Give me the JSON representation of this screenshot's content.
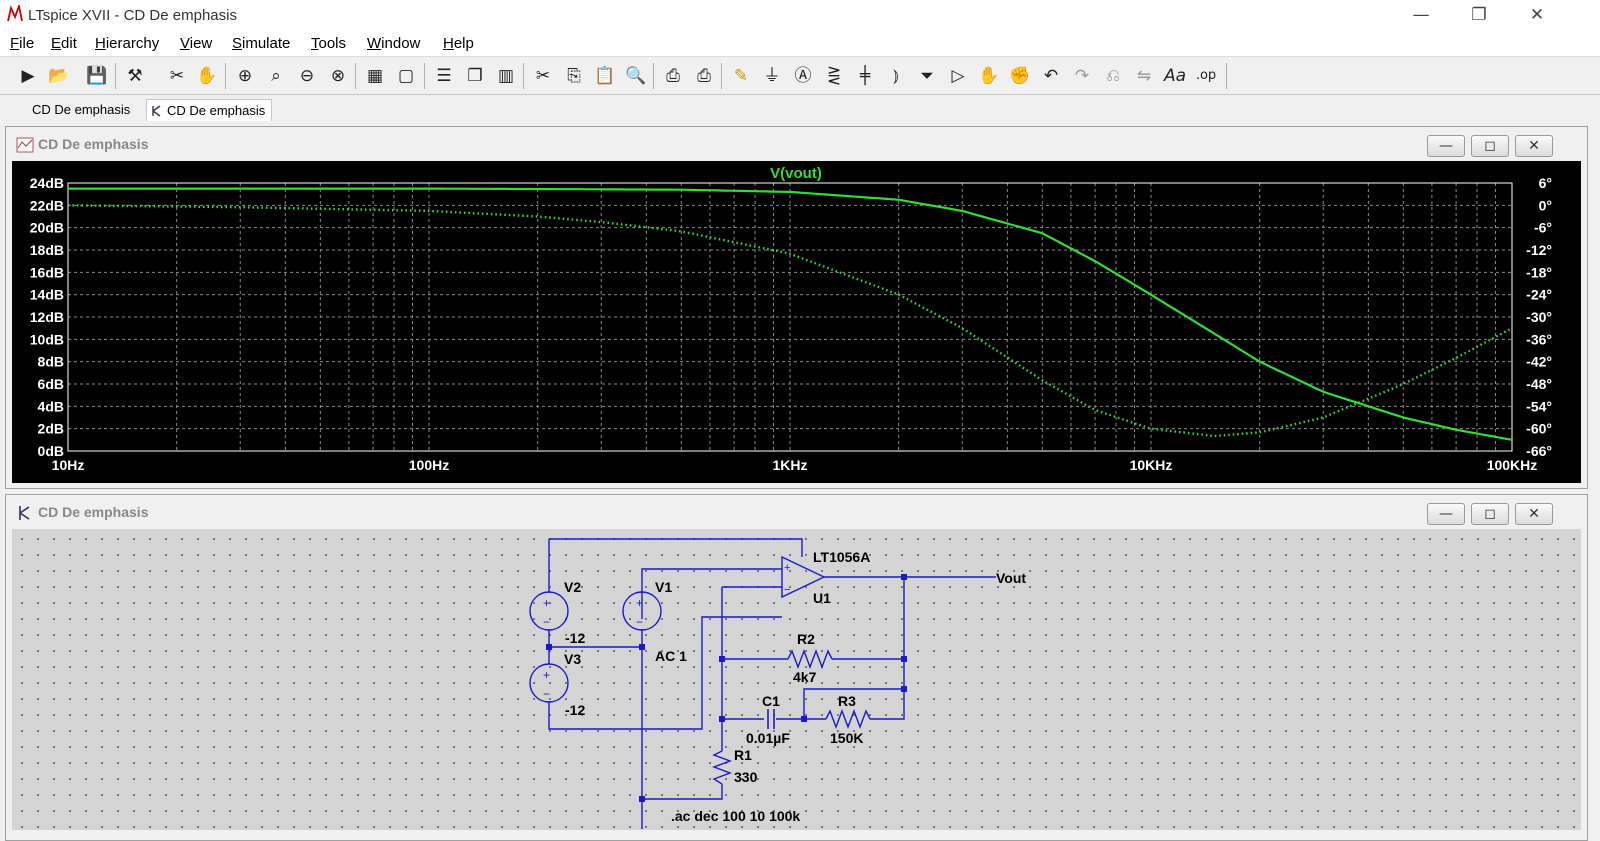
{
  "window": {
    "title": "LTspice XVII - CD De emphasis",
    "controls": {
      "minimize": "—",
      "restore": "❐",
      "close": "✕"
    }
  },
  "menu": [
    {
      "label": "File",
      "underline": "F"
    },
    {
      "label": "Edit",
      "underline": "E"
    },
    {
      "label": "Hierarchy",
      "underline": "H"
    },
    {
      "label": "View",
      "underline": "V"
    },
    {
      "label": "Simulate",
      "underline": "S"
    },
    {
      "label": "Tools",
      "underline": "T"
    },
    {
      "label": "Window",
      "underline": "W"
    },
    {
      "label": "Help",
      "underline": "H"
    }
  ],
  "toolbar_icons": [
    "run-icon",
    "open-icon",
    "save-icon",
    "control-panel-icon",
    "halt-icon",
    "pan-icon",
    "zoom-in-icon",
    "zoom-extents-icon",
    "zoom-out-icon",
    "zoom-cancel-icon",
    "autorange-icon",
    "mark-unconnected-icon",
    "tile-horizontal-icon",
    "cascade-icon",
    "tile-vertical-icon",
    "cut-icon",
    "copy-icon",
    "paste-icon",
    "find-icon",
    "print-icon",
    "print-setup-icon",
    "wire-icon",
    "ground-icon",
    "label-net-icon",
    "resistor-icon",
    "capacitor-icon",
    "inductor-icon",
    "diode-icon",
    "component-icon",
    "move-icon",
    "drag-icon",
    "undo-icon",
    "redo-icon",
    "rotate-icon",
    "mirror-icon",
    "text-icon",
    "spice-directive-icon"
  ],
  "tabs": [
    {
      "label": "CD De emphasis"
    },
    {
      "label": "CD De emphasis"
    }
  ],
  "plot_window": {
    "title": "CD De emphasis",
    "trace_name": "V(vout)",
    "trace_color": "#33dd33",
    "y_left_ticks": [
      "24dB",
      "22dB",
      "20dB",
      "18dB",
      "16dB",
      "14dB",
      "12dB",
      "10dB",
      "8dB",
      "6dB",
      "4dB",
      "2dB",
      "0dB"
    ],
    "y_right_ticks": [
      "6°",
      "0°",
      "-6°",
      "-12°",
      "-18°",
      "-24°",
      "-30°",
      "-36°",
      "-42°",
      "-48°",
      "-54°",
      "-60°",
      "-66°"
    ],
    "x_ticks": [
      "10Hz",
      "100Hz",
      "1KHz",
      "10KHz",
      "100KHz"
    ]
  },
  "chart_data": {
    "type": "line",
    "title": "V(vout)",
    "xlabel": "",
    "ylabel": "",
    "x_scale": "log",
    "xlim": [
      10,
      100000
    ],
    "ylim": [
      0,
      24
    ],
    "y2lim": [
      -66,
      6
    ],
    "grid": true,
    "series": [
      {
        "name": "V(vout)",
        "style": "solid",
        "axis": "left",
        "unit": "dB",
        "x": [
          10,
          100,
          500,
          1000,
          2000,
          3000,
          5000,
          7000,
          10000,
          15000,
          20000,
          30000,
          50000,
          70000,
          100000
        ],
        "y": [
          23.5,
          23.5,
          23.4,
          23.2,
          22.5,
          21.5,
          19.5,
          17.0,
          14.0,
          10.5,
          8.0,
          5.3,
          3.0,
          1.9,
          1.0
        ]
      },
      {
        "name": "V(vout)",
        "style": "dotted",
        "axis": "right",
        "unit": "°",
        "x": [
          10,
          30,
          100,
          200,
          300,
          500,
          1000,
          2000,
          3000,
          5000,
          7000,
          10000,
          15000,
          20000,
          30000,
          50000,
          70000,
          100000
        ],
        "y": [
          0,
          -0.5,
          -1.5,
          -3,
          -4.5,
          -7,
          -13,
          -24,
          -33,
          -47,
          -55,
          -60,
          -62,
          -61,
          -57,
          -48,
          -41,
          -33
        ]
      }
    ]
  },
  "schematic_window": {
    "title": "CD De emphasis",
    "labels": {
      "v2": "V2",
      "v2_value": "-12",
      "v3": "V3",
      "v3_value": "-12",
      "v1": "V1",
      "v1_value": "AC 1",
      "u1_model": "LT1056A",
      "u1": "U1",
      "vout": "Vout",
      "r2": "R2",
      "r2_value": "4k7",
      "c1": "C1",
      "c1_value": "0.01µF",
      "r3": "R3",
      "r3_value": "150K",
      "r1": "R1",
      "r1_value": "330",
      "directive": ".ac dec 100 10 100k",
      "opamp_plus": "+",
      "opamp_minus": "−"
    }
  }
}
